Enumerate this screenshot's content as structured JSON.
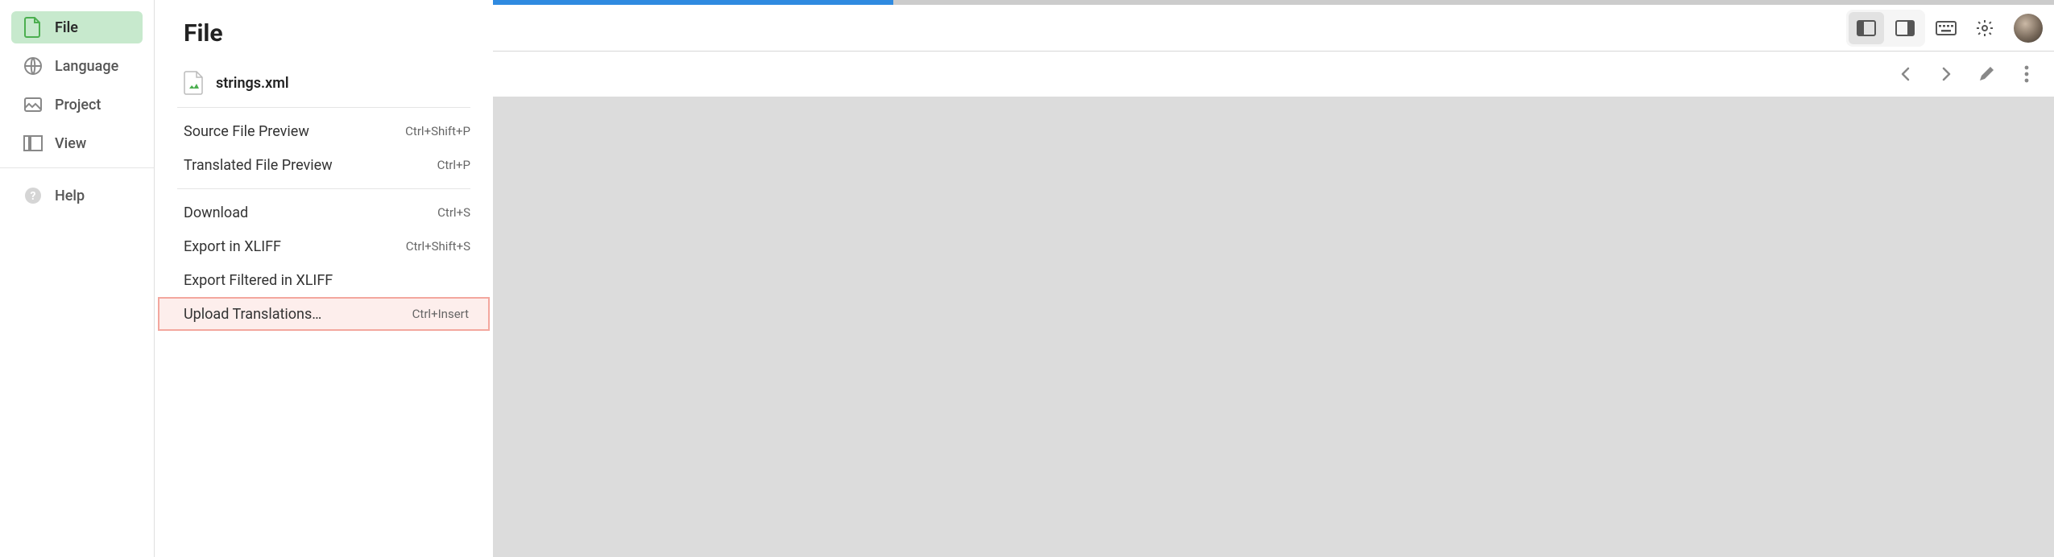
{
  "sidebar": {
    "items": [
      {
        "label": "File",
        "active": true
      },
      {
        "label": "Language",
        "active": false
      },
      {
        "label": "Project",
        "active": false
      },
      {
        "label": "View",
        "active": false
      }
    ],
    "help_label": "Help"
  },
  "panel": {
    "title": "File",
    "filename": "strings.xml",
    "groups": [
      [
        {
          "label": "Source File Preview",
          "shortcut": "Ctrl+Shift+P"
        },
        {
          "label": "Translated File Preview",
          "shortcut": "Ctrl+P"
        }
      ],
      [
        {
          "label": "Download",
          "shortcut": "Ctrl+S"
        },
        {
          "label": "Export in XLIFF",
          "shortcut": "Ctrl+Shift+S"
        },
        {
          "label": "Export Filtered in XLIFF",
          "shortcut": ""
        },
        {
          "label": "Upload Translations…",
          "shortcut": "Ctrl+Insert",
          "highlighted": true
        }
      ]
    ]
  }
}
